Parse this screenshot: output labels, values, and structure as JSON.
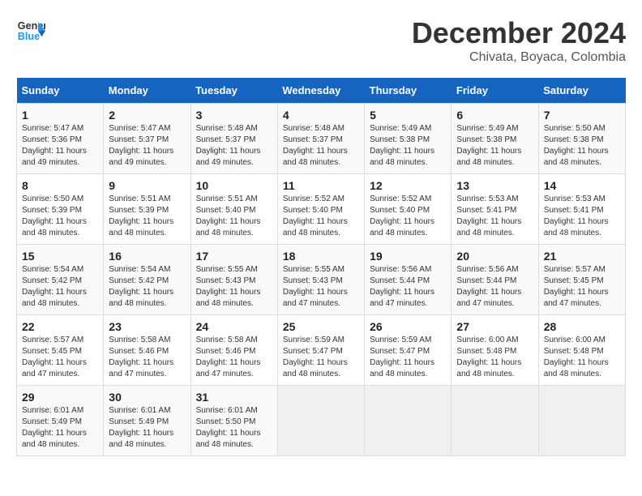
{
  "header": {
    "logo_line1": "General",
    "logo_line2": "Blue",
    "title": "December 2024",
    "subtitle": "Chivata, Boyaca, Colombia"
  },
  "calendar": {
    "days_of_week": [
      "Sunday",
      "Monday",
      "Tuesday",
      "Wednesday",
      "Thursday",
      "Friday",
      "Saturday"
    ],
    "weeks": [
      [
        {
          "day": "",
          "empty": true
        },
        {
          "day": "",
          "empty": true
        },
        {
          "day": "",
          "empty": true
        },
        {
          "day": "",
          "empty": true
        },
        {
          "day": "5",
          "info": "Sunrise: 5:49 AM\nSunset: 5:38 PM\nDaylight: 11 hours and 48 minutes."
        },
        {
          "day": "6",
          "info": "Sunrise: 5:49 AM\nSunset: 5:38 PM\nDaylight: 11 hours and 48 minutes."
        },
        {
          "day": "7",
          "info": "Sunrise: 5:50 AM\nSunset: 5:38 PM\nDaylight: 11 hours and 48 minutes."
        }
      ],
      [
        {
          "day": "1",
          "info": "Sunrise: 5:47 AM\nSunset: 5:36 PM\nDaylight: 11 hours and 49 minutes."
        },
        {
          "day": "2",
          "info": "Sunrise: 5:47 AM\nSunset: 5:37 PM\nDaylight: 11 hours and 49 minutes."
        },
        {
          "day": "3",
          "info": "Sunrise: 5:48 AM\nSunset: 5:37 PM\nDaylight: 11 hours and 49 minutes."
        },
        {
          "day": "4",
          "info": "Sunrise: 5:48 AM\nSunset: 5:37 PM\nDaylight: 11 hours and 48 minutes."
        },
        {
          "day": "5",
          "info": "Sunrise: 5:49 AM\nSunset: 5:38 PM\nDaylight: 11 hours and 48 minutes."
        },
        {
          "day": "6",
          "info": "Sunrise: 5:49 AM\nSunset: 5:38 PM\nDaylight: 11 hours and 48 minutes."
        },
        {
          "day": "7",
          "info": "Sunrise: 5:50 AM\nSunset: 5:38 PM\nDaylight: 11 hours and 48 minutes."
        }
      ],
      [
        {
          "day": "8",
          "info": "Sunrise: 5:50 AM\nSunset: 5:39 PM\nDaylight: 11 hours and 48 minutes."
        },
        {
          "day": "9",
          "info": "Sunrise: 5:51 AM\nSunset: 5:39 PM\nDaylight: 11 hours and 48 minutes."
        },
        {
          "day": "10",
          "info": "Sunrise: 5:51 AM\nSunset: 5:40 PM\nDaylight: 11 hours and 48 minutes."
        },
        {
          "day": "11",
          "info": "Sunrise: 5:52 AM\nSunset: 5:40 PM\nDaylight: 11 hours and 48 minutes."
        },
        {
          "day": "12",
          "info": "Sunrise: 5:52 AM\nSunset: 5:40 PM\nDaylight: 11 hours and 48 minutes."
        },
        {
          "day": "13",
          "info": "Sunrise: 5:53 AM\nSunset: 5:41 PM\nDaylight: 11 hours and 48 minutes."
        },
        {
          "day": "14",
          "info": "Sunrise: 5:53 AM\nSunset: 5:41 PM\nDaylight: 11 hours and 48 minutes."
        }
      ],
      [
        {
          "day": "15",
          "info": "Sunrise: 5:54 AM\nSunset: 5:42 PM\nDaylight: 11 hours and 48 minutes."
        },
        {
          "day": "16",
          "info": "Sunrise: 5:54 AM\nSunset: 5:42 PM\nDaylight: 11 hours and 48 minutes."
        },
        {
          "day": "17",
          "info": "Sunrise: 5:55 AM\nSunset: 5:43 PM\nDaylight: 11 hours and 48 minutes."
        },
        {
          "day": "18",
          "info": "Sunrise: 5:55 AM\nSunset: 5:43 PM\nDaylight: 11 hours and 47 minutes."
        },
        {
          "day": "19",
          "info": "Sunrise: 5:56 AM\nSunset: 5:44 PM\nDaylight: 11 hours and 47 minutes."
        },
        {
          "day": "20",
          "info": "Sunrise: 5:56 AM\nSunset: 5:44 PM\nDaylight: 11 hours and 47 minutes."
        },
        {
          "day": "21",
          "info": "Sunrise: 5:57 AM\nSunset: 5:45 PM\nDaylight: 11 hours and 47 minutes."
        }
      ],
      [
        {
          "day": "22",
          "info": "Sunrise: 5:57 AM\nSunset: 5:45 PM\nDaylight: 11 hours and 47 minutes."
        },
        {
          "day": "23",
          "info": "Sunrise: 5:58 AM\nSunset: 5:46 PM\nDaylight: 11 hours and 47 minutes."
        },
        {
          "day": "24",
          "info": "Sunrise: 5:58 AM\nSunset: 5:46 PM\nDaylight: 11 hours and 47 minutes."
        },
        {
          "day": "25",
          "info": "Sunrise: 5:59 AM\nSunset: 5:47 PM\nDaylight: 11 hours and 48 minutes."
        },
        {
          "day": "26",
          "info": "Sunrise: 5:59 AM\nSunset: 5:47 PM\nDaylight: 11 hours and 48 minutes."
        },
        {
          "day": "27",
          "info": "Sunrise: 6:00 AM\nSunset: 5:48 PM\nDaylight: 11 hours and 48 minutes."
        },
        {
          "day": "28",
          "info": "Sunrise: 6:00 AM\nSunset: 5:48 PM\nDaylight: 11 hours and 48 minutes."
        }
      ],
      [
        {
          "day": "29",
          "info": "Sunrise: 6:01 AM\nSunset: 5:49 PM\nDaylight: 11 hours and 48 minutes."
        },
        {
          "day": "30",
          "info": "Sunrise: 6:01 AM\nSunset: 5:49 PM\nDaylight: 11 hours and 48 minutes."
        },
        {
          "day": "31",
          "info": "Sunrise: 6:01 AM\nSunset: 5:50 PM\nDaylight: 11 hours and 48 minutes."
        },
        {
          "day": "",
          "empty": true
        },
        {
          "day": "",
          "empty": true
        },
        {
          "day": "",
          "empty": true
        },
        {
          "day": "",
          "empty": true
        }
      ]
    ]
  }
}
